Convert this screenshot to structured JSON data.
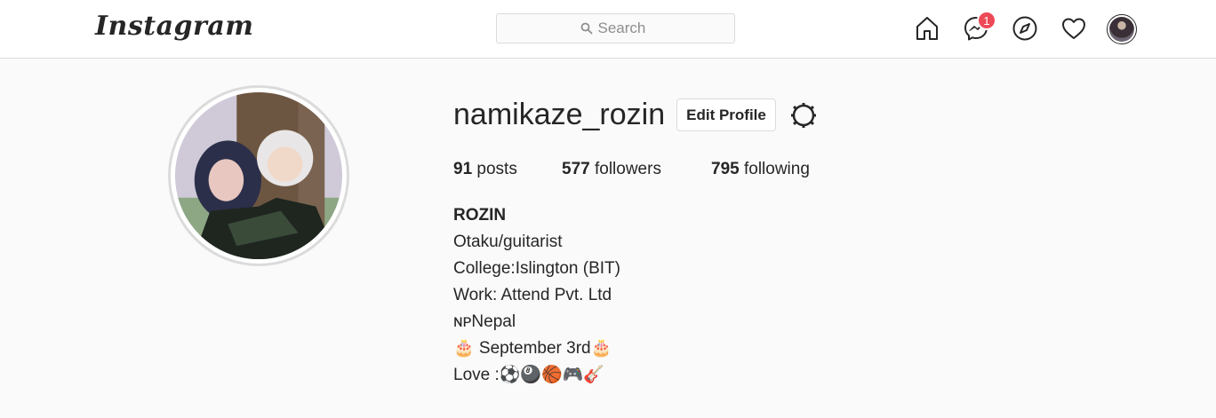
{
  "header": {
    "logo": "Instagram",
    "search_placeholder": "Search",
    "notification_count": "1",
    "icons": [
      "home-icon",
      "messenger-icon",
      "explore-icon",
      "heart-icon"
    ]
  },
  "profile": {
    "username": "namikaze_rozin",
    "edit_button": "Edit Profile",
    "stats": {
      "posts_count": "91",
      "posts_label": "posts",
      "followers_count": "577",
      "followers_label": "followers",
      "following_count": "795",
      "following_label": "following"
    },
    "bio": {
      "name": "ROZIN",
      "lines": [
        "Otaku/guitarist",
        "College:Islington (BIT)",
        "Work: Attend Pvt. Ltd",
        "ɴᴘNepal",
        "🎂 September 3rd🎂",
        "Love :⚽🎱🏀🎮🎸"
      ]
    }
  },
  "colors": {
    "badge": "#ed4956",
    "border": "#dbdbdb",
    "text": "#262626"
  }
}
